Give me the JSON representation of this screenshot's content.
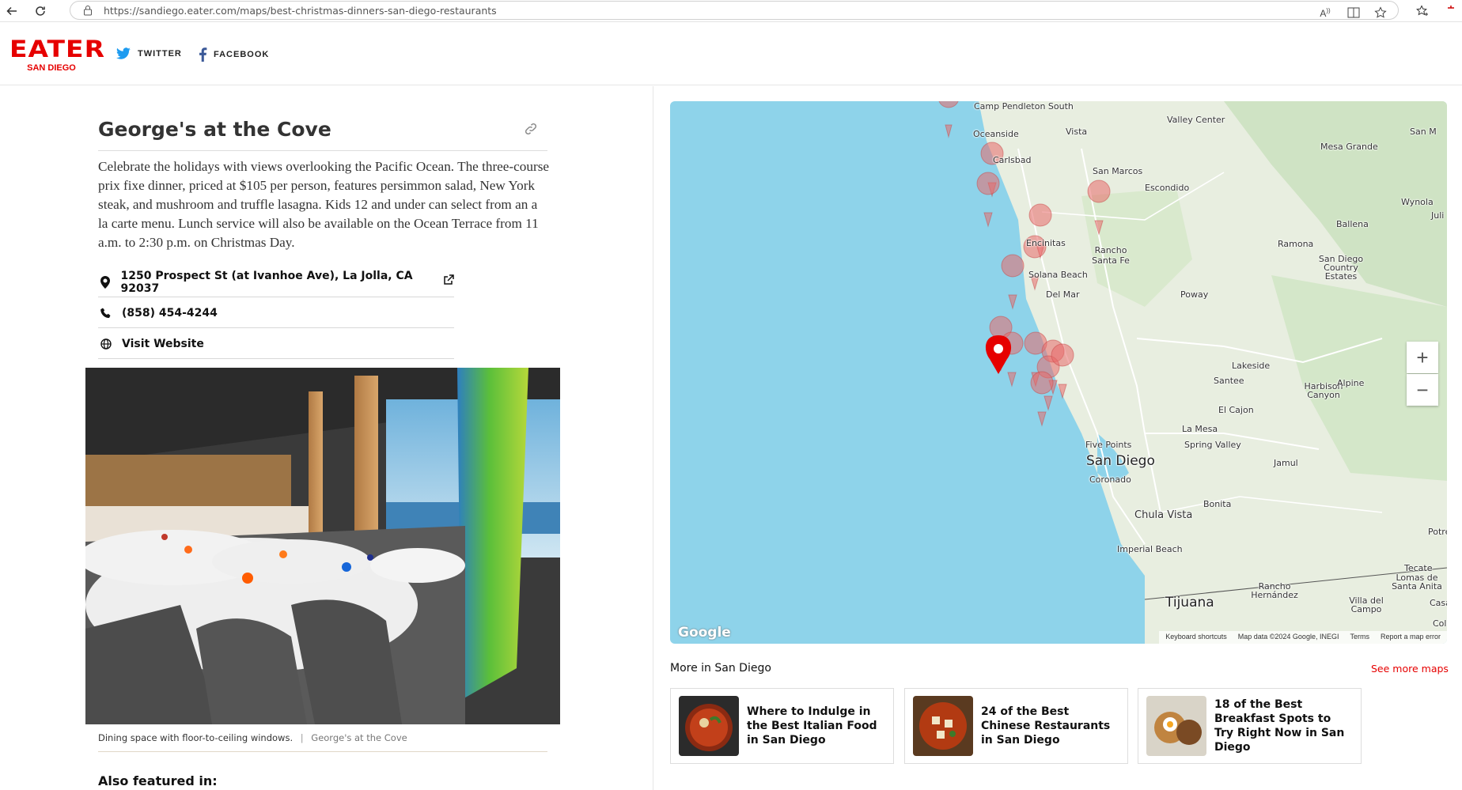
{
  "browser": {
    "url": "https://sandiego.eater.com/maps/best-christmas-dinners-san-diego-restaurants"
  },
  "header": {
    "logo_main": "EATER",
    "logo_city": "SAN DIEGO",
    "twitter": "TWITTER",
    "facebook": "FACEBOOK",
    "brand_color": "#e60000"
  },
  "place": {
    "title": "George's at the Cove",
    "description": "Celebrate the holidays with views overlooking the Pacific Ocean. The three-course prix fixe dinner, priced at $105 per person, features persimmon salad, New York steak, and mushroom and truffle lasagna. Kids 12 and under can select from an a la carte menu. Lunch service will also be available on the Ocean Terrace from 11 a.m. to 2:30 p.m. on Christmas Day.",
    "address": "1250 Prospect St (at Ivanhoe Ave), La Jolla, CA 92037",
    "phone": "(858) 454-4244",
    "website": "Visit Website",
    "caption": "Dining space with floor-to-ceiling windows.",
    "caption_credit": "George's at the Cove",
    "also_featured": "Also featured in:"
  },
  "map": {
    "labels": [
      "Camp Pendleton South",
      "Oceanside",
      "Vista",
      "Valley Center",
      "San M",
      "Mesa Grande",
      "Carlsbad",
      "San Marcos",
      "Escondido",
      "Wynola",
      "Juli",
      "Ballena",
      "Encinitas",
      "Rancho Santa Fe",
      "Ramona",
      "San Diego Country Estates",
      "Solana Beach",
      "Del Mar",
      "Poway",
      "Lakeside",
      "Santee",
      "Harbison Canyon",
      "Alpine",
      "El Cajon",
      "La Mesa",
      "Spring Valley",
      "Five Points",
      "San Diego",
      "Coronado",
      "Jamul",
      "Bonita",
      "Chula Vista",
      "Imperial Beach",
      "Potre",
      "Tecate",
      "Lomas de Santa Anita",
      "Rancho Hernández",
      "Tijuana",
      "Villa del Campo",
      "Casa",
      "Colo"
    ],
    "footer": [
      "Keyboard shortcuts",
      "Map data ©2024 Google, INEGI",
      "Terms",
      "Report a map error"
    ],
    "google": "Google",
    "zoom_in": "+",
    "zoom_out": "−",
    "water_color": "#8ed3ea",
    "land_color": "#e8eee0",
    "pin_color": "#e60000"
  },
  "more": {
    "title": "More in San Diego",
    "see_more": "See more maps",
    "cards": [
      {
        "title": "Where to Indulge in the Best Italian Food in San Diego"
      },
      {
        "title": "24 of the Best Chinese Restaurants in San Diego"
      },
      {
        "title": "18 of the Best Breakfast Spots to Try Right Now in San Diego"
      }
    ]
  }
}
